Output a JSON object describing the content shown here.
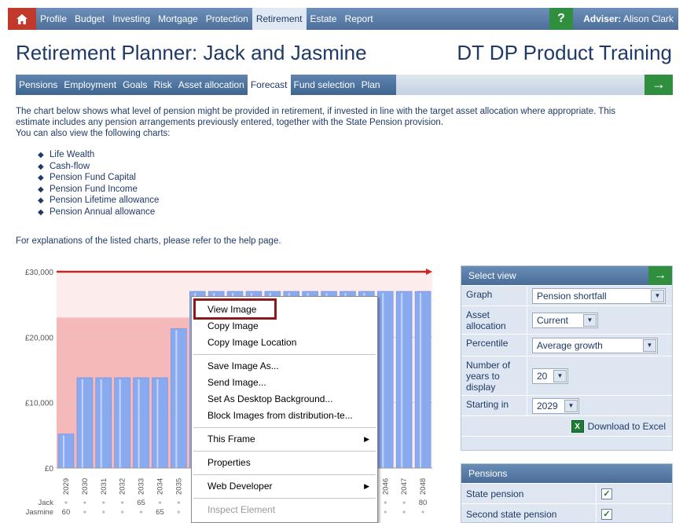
{
  "topnav": {
    "items": [
      "Profile",
      "Budget",
      "Investing",
      "Mortgage",
      "Protection",
      "Retirement",
      "Estate",
      "Report"
    ],
    "active": "Retirement",
    "help": "?",
    "adviser_label": "Adviser:",
    "adviser_name": "Alison Clark"
  },
  "page": {
    "title": "Retirement Planner: Jack and Jasmine",
    "product": "DT DP Product Training"
  },
  "subnav": {
    "tabs": [
      "Pensions",
      "Employment",
      "Goals",
      "Risk",
      "Asset allocation",
      "Forecast",
      "Fund selection",
      "Plan"
    ],
    "active": "Forecast",
    "next": "→"
  },
  "intro": {
    "line1": "The chart below shows what level of pension might be provided in retirement, if invested in line with the target asset allocation where appropriate. This",
    "line2": "estimate includes any pension arrangements previously entered, together with the State Pension provision.",
    "line3": "You can also view the following charts:"
  },
  "charts_list": [
    "Life Wealth",
    "Cash-flow",
    "Pension Fund Capital",
    "Pension Fund Income",
    "Pension Lifetime allowance",
    "Pension Annual allowance"
  ],
  "explain": "For explanations of the listed charts, please refer to the help page.",
  "chart_data": {
    "type": "bar",
    "categories": [
      "2029",
      "2030",
      "2031",
      "2032",
      "2033",
      "2034",
      "2035",
      "2036",
      "2037",
      "2038",
      "2039",
      "2040",
      "2041",
      "2042",
      "2043",
      "2044",
      "2045",
      "2046",
      "2047",
      "2048"
    ],
    "values": [
      5200,
      13800,
      13800,
      13800,
      13800,
      13800,
      21300,
      27000,
      27000,
      27000,
      27000,
      27000,
      27000,
      27000,
      27000,
      27000,
      27000,
      27000,
      27000,
      27000
    ],
    "target_line": 30000,
    "target_zone_early": 23000,
    "ylim": [
      0,
      30000
    ],
    "ytick_values": [
      0,
      10000,
      20000,
      30000
    ],
    "yticks": [
      "£0",
      "£10,000",
      "£20,000",
      "£30,000"
    ],
    "ages": {
      "Jack": [
        "",
        "",
        "",
        "",
        "65",
        "",
        "",
        "",
        "",
        "",
        "",
        "",
        "",
        "",
        "",
        "",
        "",
        "",
        "",
        "80"
      ],
      "Jasmine": [
        "60",
        "",
        "",
        "",
        "",
        "65",
        "",
        "",
        "",
        "",
        "",
        "",
        "",
        "",
        "",
        "",
        "",
        "",
        "",
        ""
      ]
    },
    "colors": {
      "bar": "#8aaaf0",
      "zone": "#f6b9b9",
      "line": "#cc2222"
    }
  },
  "select_view": {
    "title": "Select view",
    "graph_label": "Graph",
    "graph_value": "Pension shortfall",
    "asset_label": "Asset allocation",
    "asset_value": "Current",
    "percentile_label": "Percentile",
    "percentile_value": "Average growth",
    "years_label": "Number of years to display",
    "years_value": "20",
    "starting_label": "Starting in",
    "starting_value": "2029",
    "download": "Download to Excel"
  },
  "pensions_panel": {
    "title": "Pensions",
    "rows": [
      {
        "label": "State pension",
        "checked": "✓"
      },
      {
        "label": "Second state pension",
        "checked": "✓"
      }
    ]
  },
  "context_menu": {
    "items": [
      "View Image",
      "Copy Image",
      "Copy Image Location",
      "Save Image As...",
      "Send Image...",
      "Set As Desktop Background...",
      "Block Images from distribution-te...",
      "This Frame",
      "Properties",
      "Web Developer",
      "Inspect Element"
    ],
    "submenu_arrow": "▶"
  }
}
